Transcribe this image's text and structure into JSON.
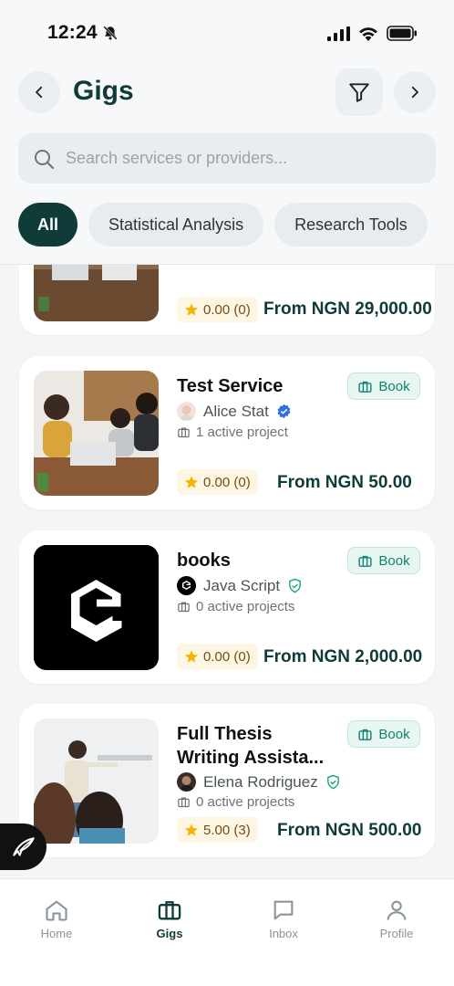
{
  "status": {
    "time": "12:24"
  },
  "header": {
    "title": "Gigs",
    "search_placeholder": "Search services or providers...",
    "filters": [
      "All",
      "Statistical Analysis",
      "Research Tools"
    ]
  },
  "gigs": [
    {
      "rating": "0.00 (0)",
      "price": "From NGN 29,000.00"
    },
    {
      "title": "Test Service",
      "book_label": "Book",
      "provider": "Alice Stat",
      "verification": "verified",
      "projects": "1 active project",
      "rating": "0.00 (0)",
      "price": "From NGN 50.00"
    },
    {
      "title": "books",
      "book_label": "Book",
      "provider": "Java Script",
      "verification": "shield",
      "projects": "0 active projects",
      "rating": "0.00 (0)",
      "price": "From NGN 2,000.00"
    },
    {
      "title": "Full Thesis Writing Assista...",
      "book_label": "Book",
      "provider": "Elena Rodriguez",
      "verification": "shield",
      "projects": "0 active projects",
      "rating": "5.00 (3)",
      "price": "From NGN 500.00"
    }
  ],
  "tabs": [
    {
      "label": "Home",
      "icon": "home-icon",
      "active": false
    },
    {
      "label": "Gigs",
      "icon": "briefcase-icon",
      "active": true
    },
    {
      "label": "Inbox",
      "icon": "chat-icon",
      "active": false
    },
    {
      "label": "Profile",
      "icon": "user-icon",
      "active": false
    }
  ],
  "colors": {
    "brand": "#0f3b38",
    "accent": "#12836f",
    "star": "#f5b400"
  }
}
